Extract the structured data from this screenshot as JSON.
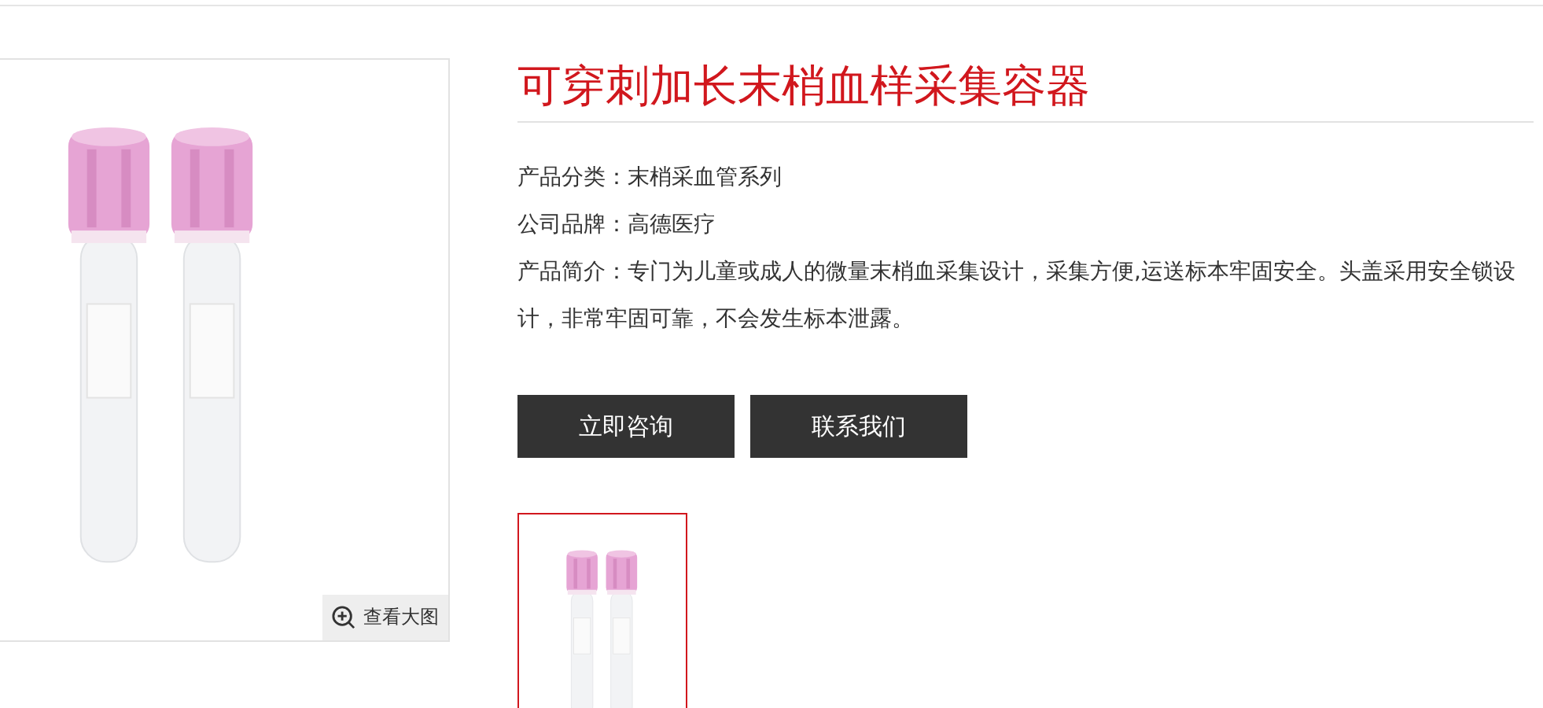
{
  "product": {
    "title": "可穿刺加长末梢血样采集容器",
    "fields": [
      {
        "label": "产品分类：",
        "value": "末梢采血管系列"
      },
      {
        "label": "公司品牌：",
        "value": "高德医疗"
      },
      {
        "label": "产品简介：",
        "value": "专门为儿童或成人的微量末梢血采集设计，采集方便,运送标本牢固安全。头盖采用安全锁设计，非常牢固可靠，不会发生标本泄露。"
      }
    ],
    "buttons": [
      "立即咨询",
      "联系我们"
    ]
  },
  "gallery": {
    "zoom_label": "查看大图",
    "thumbnails": [
      {
        "selected": true
      }
    ]
  }
}
